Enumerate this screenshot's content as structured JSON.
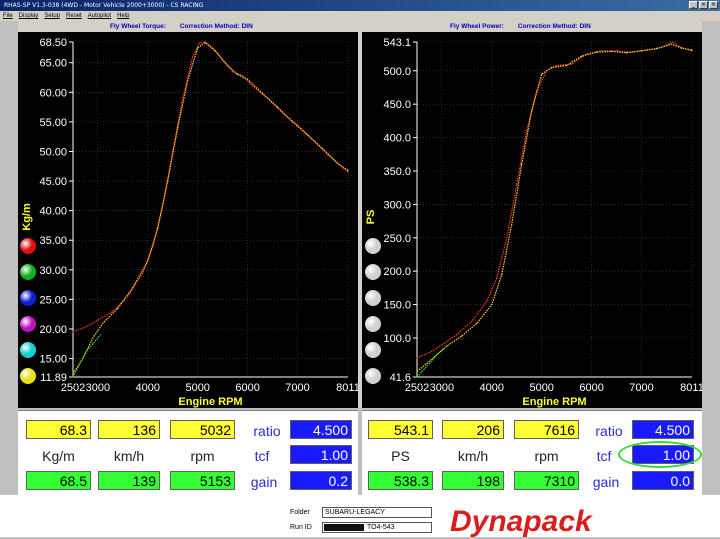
{
  "window": {
    "title": "RHAS-SP V1.3-038  (4WD - Motor Vehicle 2000+3000) - CS RACING",
    "buttons": [
      "_",
      "×",
      "×"
    ]
  },
  "menu": [
    "File",
    "Display",
    "Setup",
    "Reset",
    "Autopilot",
    "Help"
  ],
  "left_panel": {
    "header_title": "Fly Wheel Torque:",
    "header_correction": "Correction Method: DIN",
    "swatch_colors": [
      "#e01010",
      "#10b020",
      "#1020d0",
      "#c010c0",
      "#10d0d0",
      "#e8e010"
    ]
  },
  "right_panel": {
    "header_title": "Fly Wheel Power:",
    "header_correction": "Correction Method: DIN",
    "swatch_colors": [
      "#d0d0d0",
      "#d0d0d0",
      "#d0d0d0",
      "#d0d0d0",
      "#d0d0d0",
      "#d0d0d0"
    ]
  },
  "chart_data": [
    {
      "type": "line",
      "xlabel": "Engine RPM",
      "ylabel": "Kg/m",
      "xlim": [
        2502,
        8011
      ],
      "ylim": [
        11.89,
        68.5
      ],
      "x_ticks": [
        "2502",
        "3000",
        "4000",
        "5000",
        "6000",
        "7000",
        "8011"
      ],
      "y_ticks": [
        "68.50",
        "65.00",
        "60.00",
        "55.00",
        "50.00",
        "45.00",
        "40.00",
        "35.00",
        "30.00",
        "25.00",
        "20.00",
        "15.00",
        "11.89"
      ],
      "series": [
        {
          "color": "#ff3030",
          "x": [
            2502,
            2800,
            3000,
            3300,
            3600,
            3900,
            4100,
            4300,
            4500,
            4700,
            4900,
            5030,
            5150,
            5300,
            5500,
            5700,
            5900,
            6100,
            6400,
            6700,
            7000,
            7300,
            7600,
            8011
          ],
          "y": [
            19.5,
            20.5,
            21.5,
            23,
            25.5,
            29.5,
            34,
            41,
            50,
            59,
            66,
            68.3,
            68.5,
            67.5,
            65.5,
            63.5,
            62.8,
            61,
            59,
            56.5,
            54.5,
            52,
            49.5,
            46.5
          ]
        },
        {
          "color": "#ffd020",
          "x": [
            2502,
            2700,
            2900,
            3100,
            3400,
            3700,
            4000,
            4200,
            4400,
            4600,
            4800,
            5000,
            5150,
            5350,
            5600,
            5800,
            6000,
            6300,
            6600,
            6900,
            7200,
            7500,
            7800,
            8011
          ],
          "y": [
            12.5,
            15,
            18.5,
            21,
            23.5,
            27,
            31.5,
            37,
            45,
            54,
            62,
            67.5,
            68.4,
            67,
            64.5,
            63,
            62.2,
            59.8,
            57.5,
            55,
            52.8,
            50.5,
            48,
            46.8
          ]
        },
        {
          "color": "#30e030",
          "x": [
            2502,
            2600,
            2750,
            2900,
            3050
          ],
          "y": [
            11.89,
            13.5,
            16,
            17.5,
            19
          ]
        }
      ]
    },
    {
      "type": "line",
      "xlabel": "Engine RPM",
      "ylabel": "PS",
      "xlim": [
        2502,
        8011
      ],
      "ylim": [
        41.6,
        543.1
      ],
      "x_ticks": [
        "2502",
        "3000",
        "4000",
        "5000",
        "6000",
        "7000",
        "8011"
      ],
      "y_ticks": [
        "543.1",
        "500.0",
        "450.0",
        "400.0",
        "350.0",
        "300.0",
        "250.0",
        "200.0",
        "150.0",
        "100.0",
        "41.6"
      ],
      "series": [
        {
          "color": "#ff3030",
          "x": [
            2502,
            2800,
            3000,
            3300,
            3600,
            3900,
            4100,
            4300,
            4500,
            4700,
            4900,
            5100,
            5300,
            5600,
            5900,
            6200,
            6500,
            6800,
            7100,
            7400,
            7616,
            7800,
            8011
          ],
          "y": [
            70,
            80,
            90,
            105,
            125,
            155,
            190,
            250,
            330,
            410,
            470,
            500,
            508,
            510,
            525,
            530,
            530,
            528,
            531,
            535,
            543.1,
            535,
            530
          ]
        },
        {
          "color": "#ffd020",
          "x": [
            2502,
            2700,
            2900,
            3100,
            3400,
            3700,
            4000,
            4200,
            4400,
            4600,
            4800,
            5000,
            5200,
            5500,
            5800,
            6100,
            6400,
            6700,
            7000,
            7300,
            7600,
            7800,
            8011
          ],
          "y": [
            50,
            62,
            75,
            88,
            103,
            122,
            150,
            195,
            270,
            360,
            440,
            495,
            505,
            508,
            522,
            528,
            529,
            527,
            530,
            533,
            540,
            534,
            531
          ]
        },
        {
          "color": "#30e030",
          "x": [
            2502,
            2600,
            2750,
            2900,
            3050
          ],
          "y": [
            41.6,
            50,
            62,
            75,
            85
          ]
        }
      ]
    }
  ],
  "readouts": {
    "left": {
      "top_values": [
        "68.3",
        "136",
        "5032"
      ],
      "labels": [
        "Kg/m",
        "km/h",
        "rpm"
      ],
      "bottom_values": [
        "68.5",
        "139",
        "5153"
      ],
      "ratio_label": "ratio",
      "ratio_value": "4.500",
      "tcf_label": "tcf",
      "tcf_value": "1.00",
      "gain_label": "gain",
      "gain_value": "0.2"
    },
    "right": {
      "top_values": [
        "543.1",
        "206",
        "7616"
      ],
      "labels": [
        "PS",
        "km/h",
        "rpm"
      ],
      "bottom_values": [
        "538.3",
        "198",
        "7310"
      ],
      "ratio_label": "ratio",
      "ratio_value": "4.500",
      "tcf_label": "tcf",
      "tcf_value": "1.00",
      "gain_label": "gain",
      "gain_value": "0.0"
    }
  },
  "footer": {
    "folder_label": "Folder",
    "folder_value": "SUBARU-LEGACY",
    "runid_label": "Run ID",
    "runid_value": "TO4-543",
    "logo": "Dynapack"
  }
}
